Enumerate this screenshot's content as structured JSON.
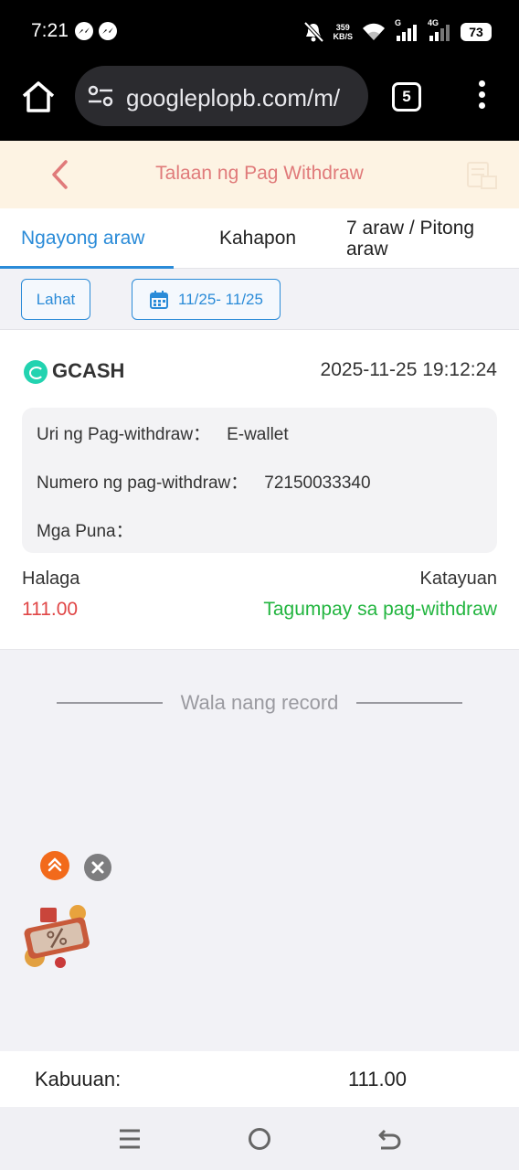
{
  "status_bar": {
    "time": "7:21",
    "net_speed_value": "359",
    "net_speed_unit": "KB/S",
    "signal_label_1": "G",
    "signal_label_2": "4G",
    "battery": "73"
  },
  "browser": {
    "url": "googleplopb.com/m/",
    "tab_count": "5"
  },
  "header": {
    "title": "Talaan ng Pag Withdraw"
  },
  "tabs": [
    {
      "label": "Ngayong araw",
      "active": true
    },
    {
      "label": "Kahapon",
      "active": false
    },
    {
      "label": "7 araw / Pitong araw",
      "active": false
    }
  ],
  "filters": {
    "all_label": "Lahat",
    "date_range": "11/25- 11/25"
  },
  "record": {
    "method": "GCASH",
    "datetime": "2025-11-25 19:12:24",
    "type_label": "Uri ng Pag-withdraw：",
    "type_value": "E-wallet",
    "number_label": "Numero ng pag-withdraw：",
    "number_value": "72150033340",
    "remarks_label": "Mga Puna：",
    "remarks_value": "",
    "amount_label": "Halaga",
    "amount_value": "111.00",
    "status_label": "Katayuan",
    "status_value": "Tagumpay sa pag-withdraw"
  },
  "list_end_text": "Wala nang record",
  "total": {
    "label": "Kabuuan:",
    "value": "111.00"
  },
  "colors": {
    "accent_blue": "#2a8bd8",
    "title_pink": "#e07a7a",
    "amount_red": "#e04646",
    "success_green": "#22b53f",
    "header_bg": "#fdf3e3",
    "gcash_teal": "#22d3b0"
  },
  "icons": {
    "back": "chevron-left-icon",
    "doc": "document-icon",
    "calendar": "calendar-icon",
    "scroll_top": "double-chevron-up-icon",
    "close": "close-icon"
  }
}
